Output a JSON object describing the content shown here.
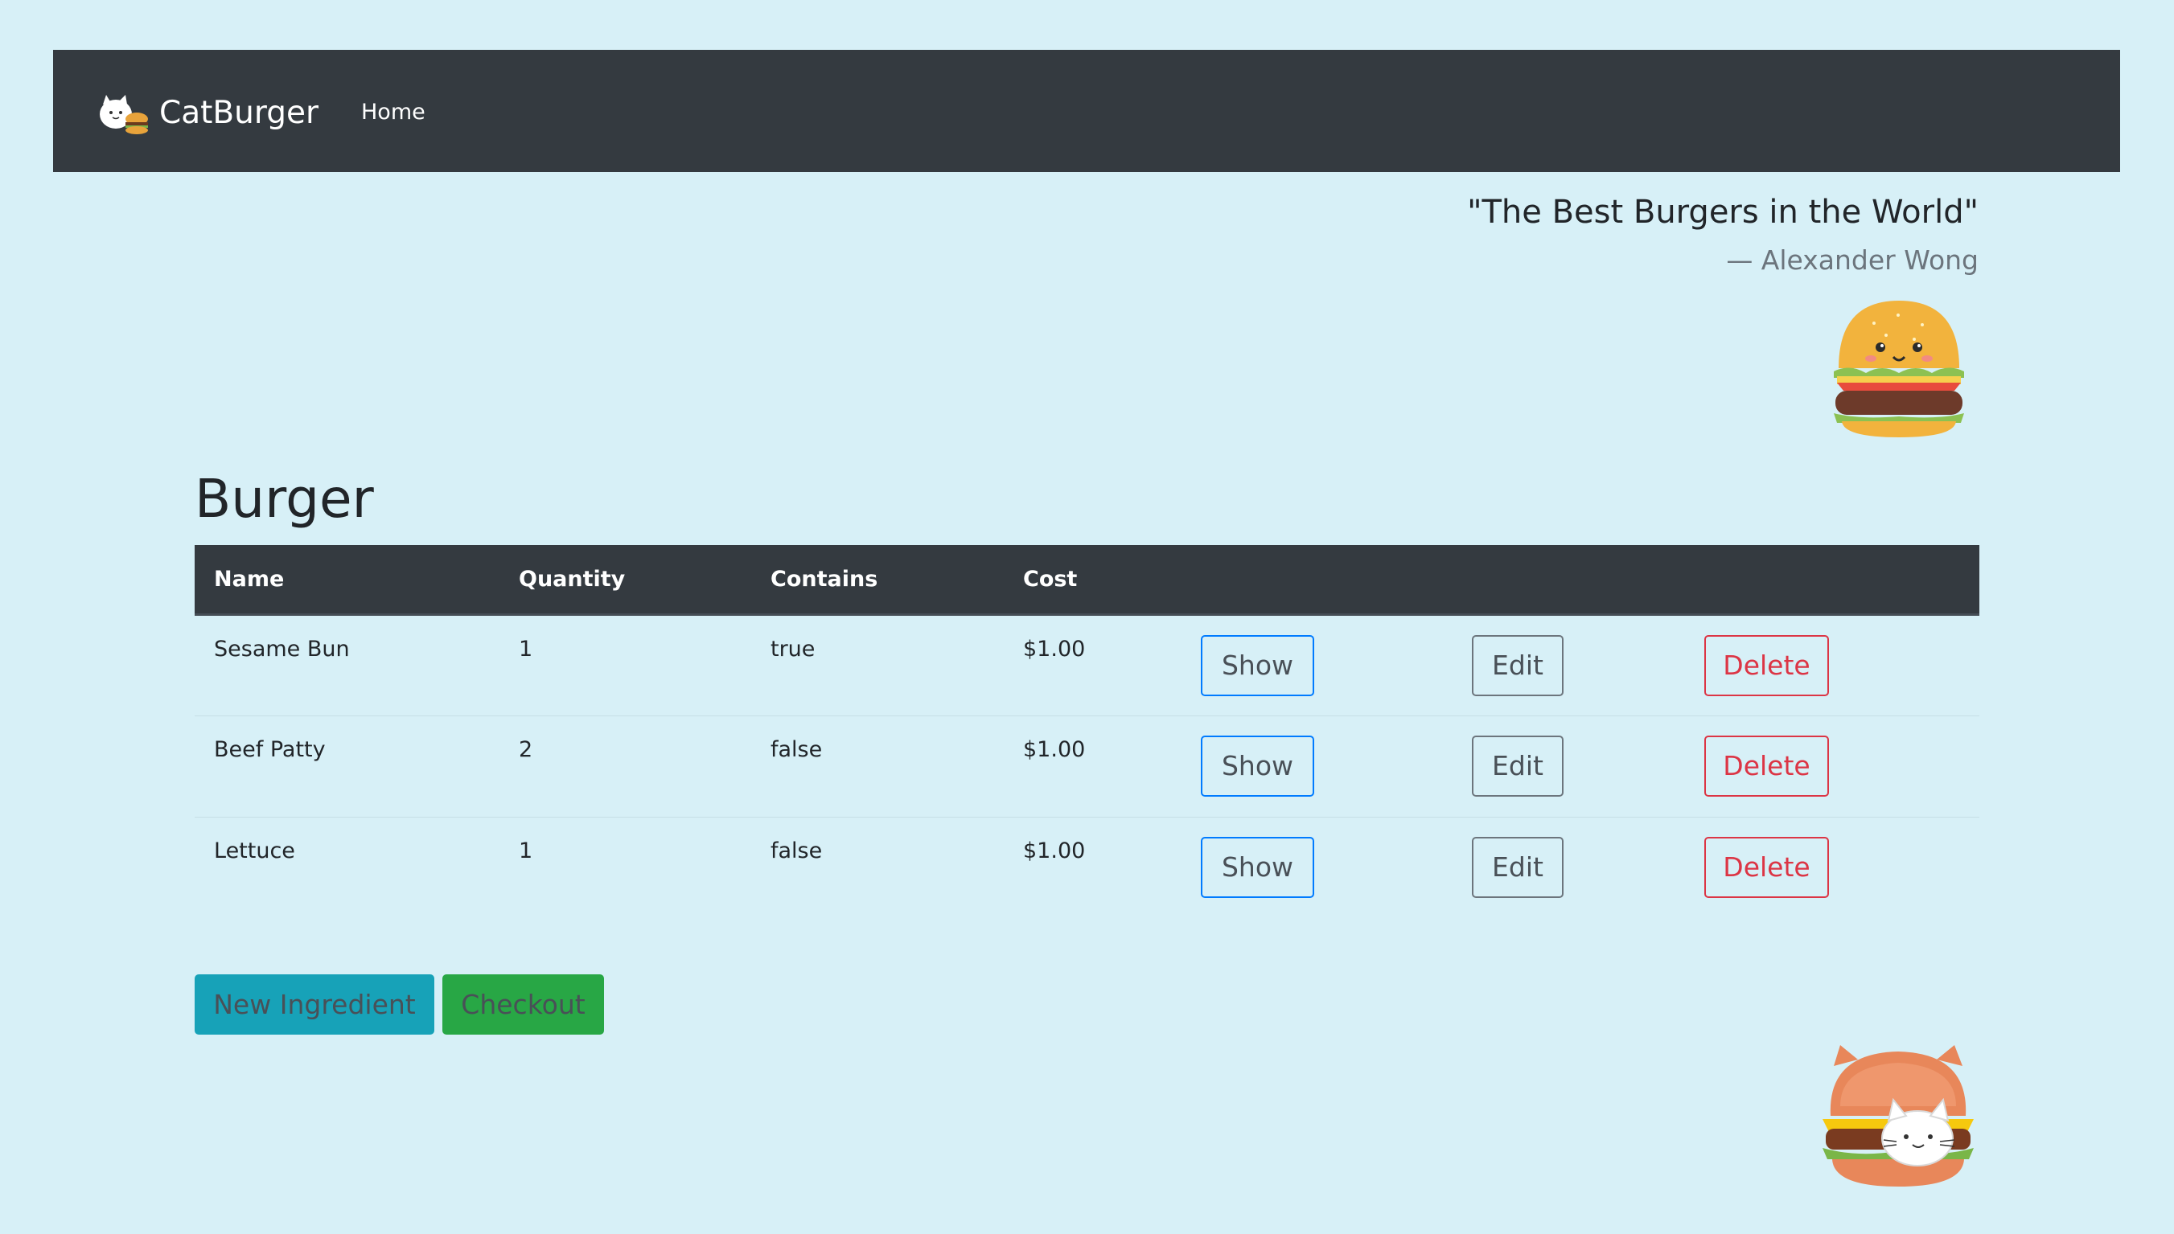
{
  "navbar": {
    "brand_name": "CatBurger",
    "home_label": "Home",
    "background": "#343a40"
  },
  "quote": {
    "text": "\"The Best Burgers in the World\"",
    "author": "— Alexander Wong"
  },
  "page": {
    "title": "Burger",
    "background": "#d7f0f7"
  },
  "table": {
    "headers": [
      "Name",
      "Quantity",
      "Contains",
      "Cost"
    ],
    "rows": [
      {
        "name": "Sesame Bun",
        "quantity": "1",
        "contains": "true",
        "cost": "$1.00",
        "show": "Show",
        "edit": "Edit",
        "delete": "Delete"
      },
      {
        "name": "Beef Patty",
        "quantity": "2",
        "contains": "false",
        "cost": "$1.00",
        "show": "Show",
        "edit": "Edit",
        "delete": "Delete"
      },
      {
        "name": "Lettuce",
        "quantity": "1",
        "contains": "false",
        "cost": "$1.00",
        "show": "Show",
        "edit": "Edit",
        "delete": "Delete"
      }
    ]
  },
  "actions": {
    "new_ingredient": "New Ingredient",
    "checkout": "Checkout"
  },
  "colors": {
    "primary": "#007bff",
    "secondary": "#6c757d",
    "danger": "#dc3545",
    "info": "#17a2b8",
    "success": "#28a745"
  },
  "icons": {
    "brand": "cat-burger-logo-icon",
    "burger": "cute-burger-illustration",
    "catburger": "cat-in-burger-illustration"
  }
}
